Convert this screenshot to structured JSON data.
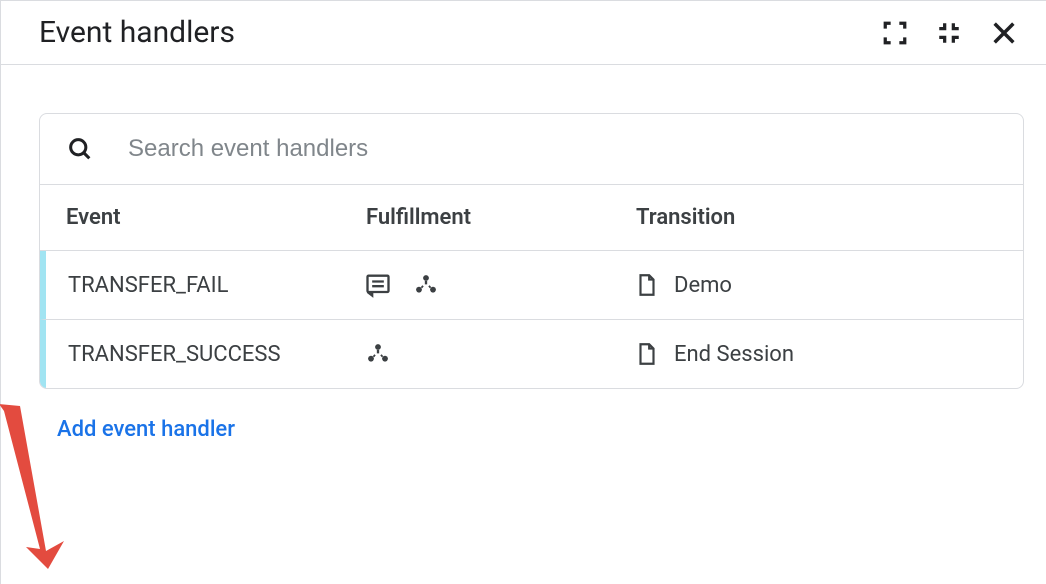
{
  "header": {
    "title": "Event handlers"
  },
  "search": {
    "placeholder": "Search event handlers",
    "value": ""
  },
  "columns": {
    "event": "Event",
    "fulfillment": "Fulfillment",
    "transition": "Transition"
  },
  "rows": [
    {
      "event": "TRANSFER_FAIL",
      "fulfillment_icons": [
        "message-icon",
        "webhook-icon"
      ],
      "transition_icon": "page-icon",
      "transition_label": "Demo"
    },
    {
      "event": "TRANSFER_SUCCESS",
      "fulfillment_icons": [
        "webhook-icon"
      ],
      "transition_icon": "page-icon",
      "transition_label": "End Session"
    }
  ],
  "add_link": "Add event handler",
  "colors": {
    "link": "#1a73e8",
    "row_accent": "#a1e4f2",
    "arrow": "#e34b3f"
  }
}
